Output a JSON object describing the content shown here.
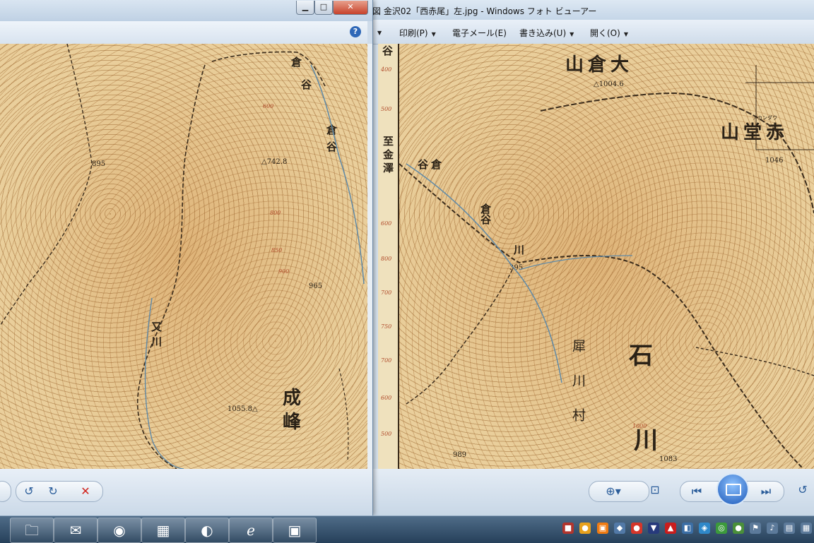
{
  "viewer": {
    "title": "図 金沢02「西赤尾」左.jpg - Windows フォト ビューアー",
    "menu": [
      {
        "label": "印刷(P)"
      },
      {
        "label": "電子メール(E)"
      },
      {
        "label": "書き込み(U)"
      },
      {
        "label": "開く(O)"
      }
    ]
  },
  "left_map": {
    "labels": {
      "kura1": "倉",
      "tani1": "谷",
      "kura2": "倉",
      "tani2": "谷",
      "p895": "895",
      "p742": "△742.8",
      "p965": "965",
      "p1055": "1055.8△",
      "naru": "成",
      "mine": "峰",
      "kawa_vert": "又川",
      "c600": "600",
      "c800": "800",
      "c850": "850",
      "c900": "900"
    }
  },
  "right_map": {
    "margin": {
      "top_char": "谷",
      "dest": "至金澤",
      "ticks": [
        "400",
        "500",
        "600",
        "800",
        "700",
        "750",
        "700",
        "600",
        "500"
      ]
    },
    "labels": {
      "ookurayama": "山倉大",
      "p1004": "△1004.6",
      "akadouyama": "山堂赤",
      "furigana": "アカンダウ",
      "p1046": "1046",
      "kuradani": "谷倉",
      "p395": "395",
      "kura_vert": "倉谷",
      "gawa": "川",
      "ishi": "石",
      "kawa": "川",
      "saigawa_vert": "犀川村",
      "p989": "989",
      "p1083": "1083",
      "c1000": "1000"
    }
  },
  "taskbar": {
    "buttons": [
      "folder-icon",
      "mail-icon",
      "firefox-icon",
      "control-panel-icon",
      "media-icon",
      "ie-icon",
      "photo-viewer-icon"
    ]
  },
  "colors": {
    "map_paper": "#e9cf9c",
    "contour": "#a8632c",
    "taskbar": "#26405a"
  }
}
